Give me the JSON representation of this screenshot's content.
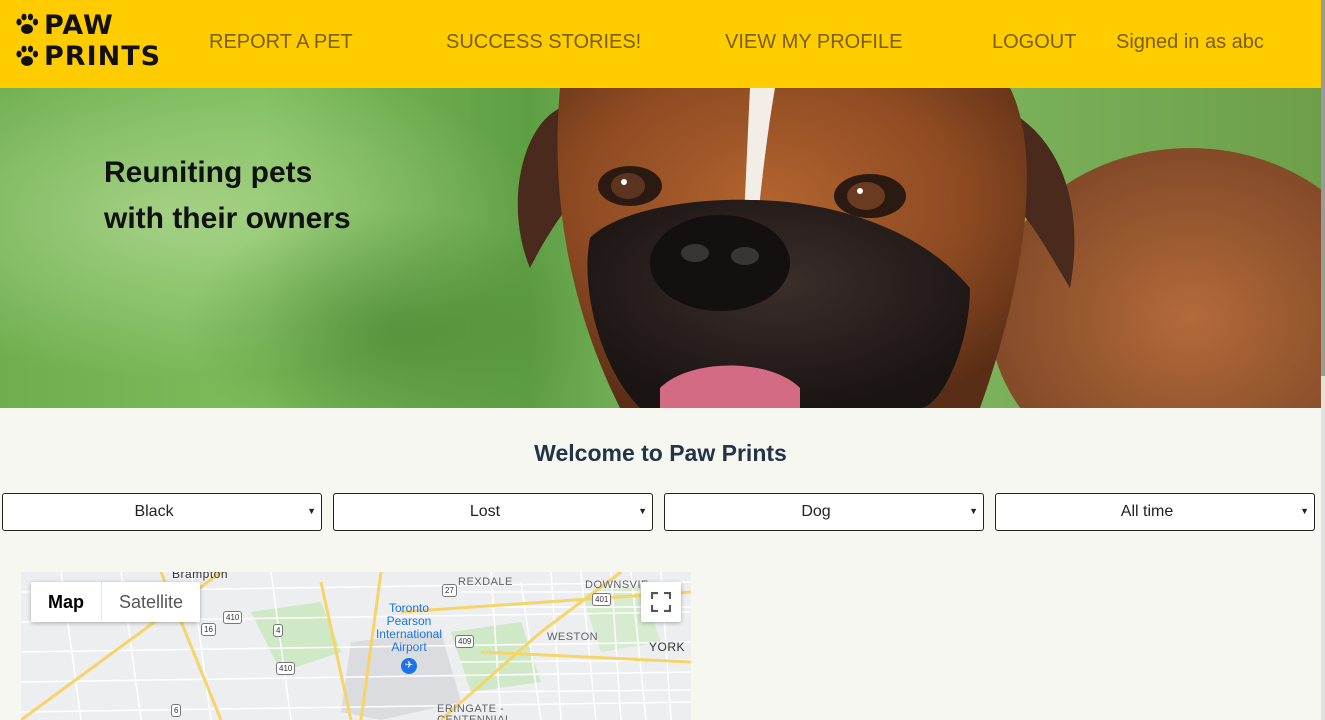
{
  "brand": {
    "line1": "PAW",
    "line2": "PRINTS"
  },
  "nav": {
    "report": "REPORT A PET",
    "stories": "SUCCESS STORIES!",
    "profile": "VIEW MY PROFILE",
    "logout": "LOGOUT",
    "signed_in": "Signed in as abc"
  },
  "hero": {
    "line1": "Reuniting pets",
    "line2": "with their owners"
  },
  "welcome": "Welcome to Paw Prints",
  "filters": {
    "color": "Black",
    "status": "Lost",
    "type": "Dog",
    "time": "All time"
  },
  "map": {
    "toggle": {
      "map": "Map",
      "satellite": "Satellite"
    },
    "labels": {
      "brampton": "Brampton",
      "rexdale": "REXDALE",
      "downsview": "DOWNSVIE",
      "weston": "WESTON",
      "york": "YORK",
      "airport": "Toronto Pearson International Airport",
      "etobicoke": "ERINGATE - CENTENNIAL"
    },
    "shields": {
      "s27": "27",
      "s401": "401",
      "s410a": "410",
      "s16": "16",
      "s4": "4",
      "s409": "409",
      "s410b": "410",
      "s6": "6"
    }
  },
  "colors": {
    "header": "#ffcc00",
    "nav_text": "#7a5f00",
    "welcome_text": "#233446",
    "background": "#f6f7f0"
  }
}
